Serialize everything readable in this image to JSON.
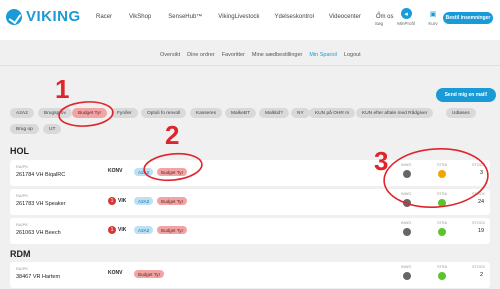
{
  "header": {
    "logo_text": "VIKING",
    "nav": [
      "Racer",
      "VikShop",
      "SenseHub™",
      "VikingLivestock",
      "Ydelseskontrol",
      "Videocenter",
      "Om os"
    ],
    "icons": [
      {
        "icon": "search-icon",
        "label": "Søg"
      },
      {
        "icon": "profile-icon",
        "label": "MinProfil"
      },
      {
        "icon": "cart-icon",
        "label": "Kurv"
      }
    ],
    "cta": "Bestil insemninger"
  },
  "subnav": {
    "items": [
      "Oversikt",
      "Dine ordrer",
      "Favoritter",
      "Mine sædbestillinger",
      "Min Sparoil",
      "Logout"
    ],
    "active_index": 4
  },
  "send_button": "Send mig en mail!",
  "filter_chips": [
    "A2A2",
    "Brugsprov",
    "Budget Tyr",
    "Fyn/ler",
    "Optuli fo renvoll",
    "Kasseres",
    "MalkeBT",
    "Malktid?",
    "NY",
    "KUN på OHR m",
    "KUN efter aftale med Rådgiver",
    "Udløses",
    "Brug op",
    "UT"
  ],
  "chip_red_index": 2,
  "sections": [
    {
      "title": "HOL",
      "rows": [
        {
          "label": "RA/PK",
          "name": "261784 VH BiqalRC",
          "type": "KONV",
          "badge": "",
          "tags": [
            "A2A2",
            "Budget Tyr"
          ],
          "col_labels": [
            "INWG",
            "STRA",
            "STOCK"
          ],
          "dot1": "#666666",
          "dot2": "#f5a300",
          "stock": "3"
        },
        {
          "label": "RA/PK",
          "name": "261783 VH Speaker",
          "type": "VIK",
          "badge": "1",
          "tags": [
            "A2A2",
            "Budget Tyr"
          ],
          "col_labels": [
            "INWG",
            "STRA",
            "STOCK"
          ],
          "dot1": "#666666",
          "dot2": "#5cc42b",
          "stock": "24"
        },
        {
          "label": "RA/PK",
          "name": "261063 VH Beech",
          "type": "VIK",
          "badge": "1",
          "tags": [
            "A2A2",
            "Budget Tyr"
          ],
          "col_labels": [
            "INWG",
            "STRA",
            "STOCK"
          ],
          "dot1": "#666666",
          "dot2": "#5cc42b",
          "stock": "19"
        }
      ]
    },
    {
      "title": "RDM",
      "rows": [
        {
          "label": "RA/PK",
          "name": "38467 VR Hartem",
          "type": "KONV",
          "badge": "",
          "tags": [
            "Budget Tyr"
          ],
          "col_labels": [
            "INWG",
            "STRA",
            "STOCK"
          ],
          "dot1": "#666666",
          "dot2": "#5cc42b",
          "stock": "2"
        }
      ]
    }
  ],
  "annotations": [
    "1",
    "2",
    "3"
  ],
  "colors": {
    "accent": "#1a9bd7",
    "annotation": "#e0242c"
  }
}
